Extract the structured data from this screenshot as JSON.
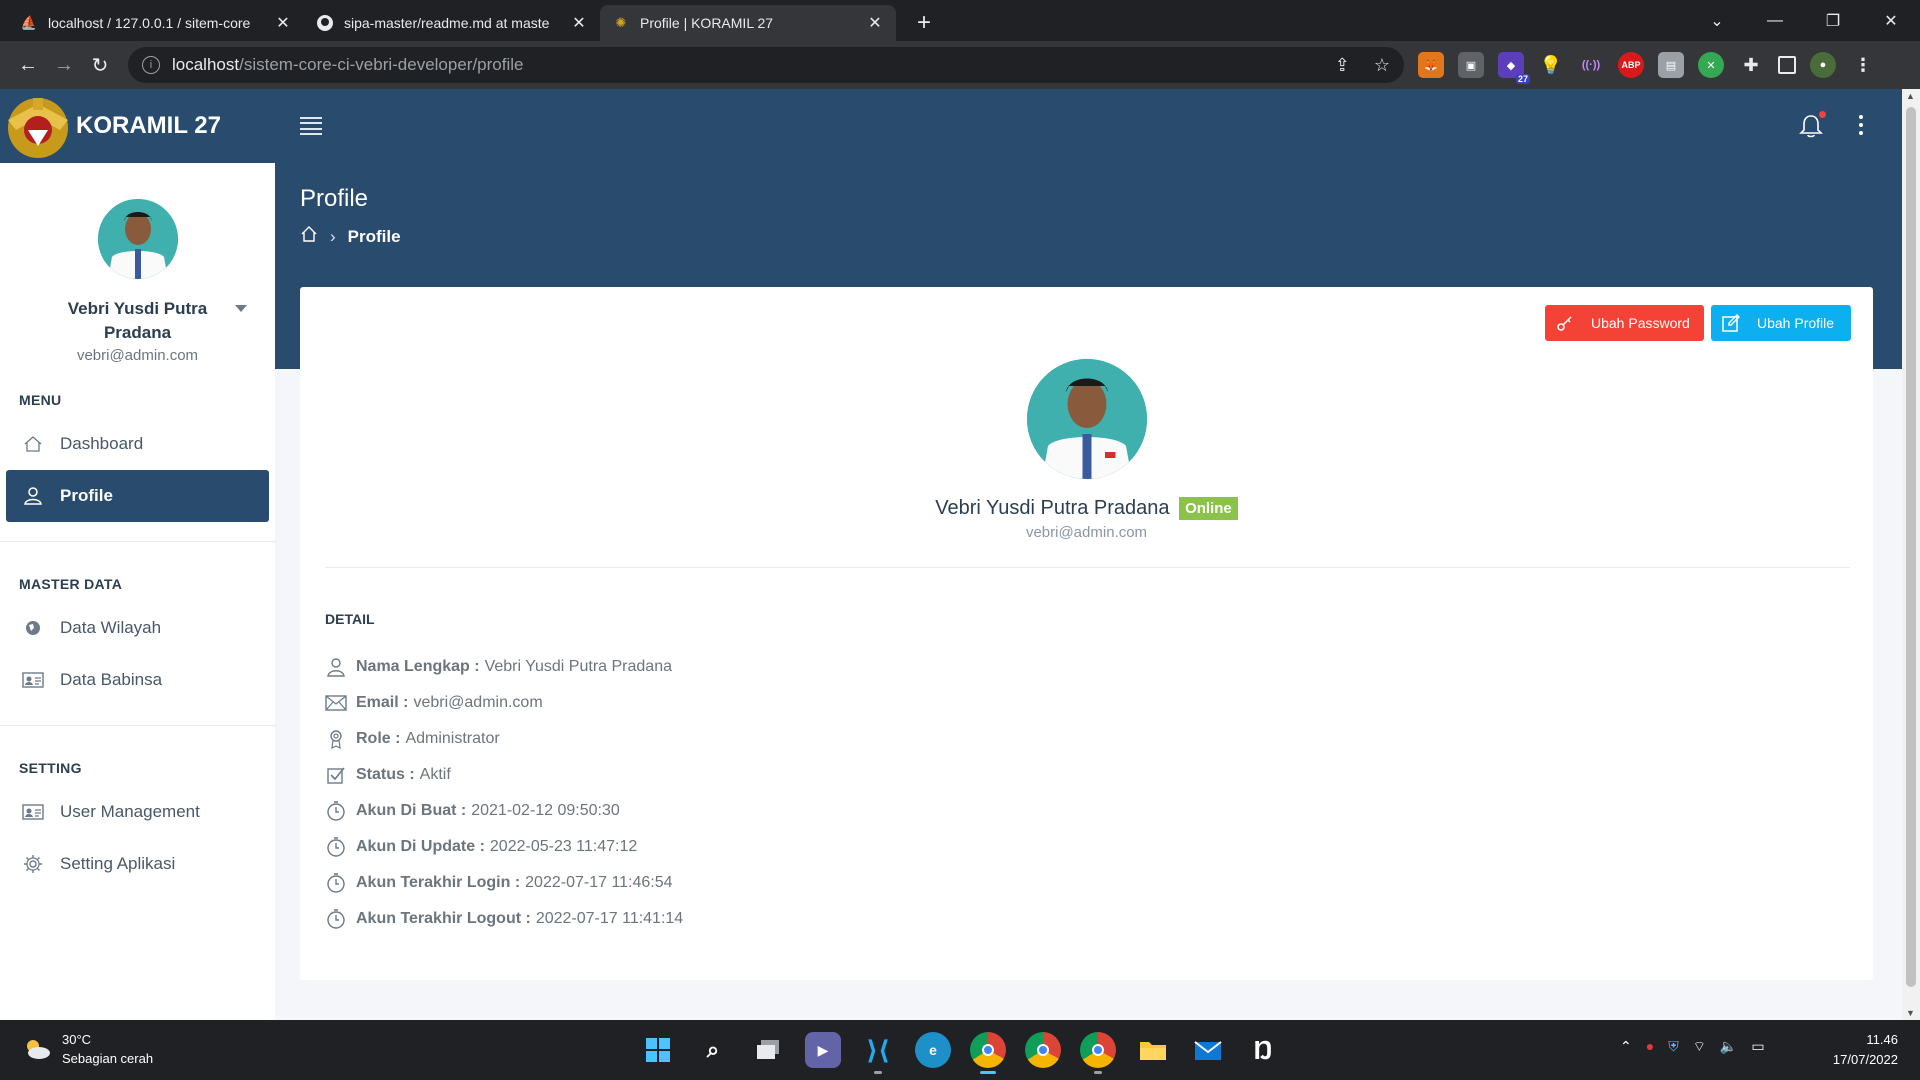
{
  "browser": {
    "tabs": [
      {
        "title": "localhost / 127.0.0.1 / sitem-core",
        "icon": "phpmyadmin-icon"
      },
      {
        "title": "sipa-master/readme.md at maste",
        "icon": "github-icon"
      },
      {
        "title": "Profile | KORAMIL 27",
        "icon": "koramil-logo-icon",
        "active": true
      }
    ],
    "address_host": "localhost",
    "address_path": "/sistem-core-ci-vebri-developer/profile",
    "extension_badge": "27",
    "abp_label": "ABP"
  },
  "app": {
    "brand_name": "KORAMIL 27",
    "page_title": "Profile",
    "breadcrumb_current": "Profile"
  },
  "sidebar": {
    "user_name": "Vebri Yusdi Putra Pradana",
    "user_email": "vebri@admin.com",
    "sections": [
      {
        "heading": "MENU",
        "items": [
          {
            "label": "Dashboard",
            "icon": "home-icon"
          },
          {
            "label": "Profile",
            "icon": "user-icon",
            "active": true
          }
        ]
      },
      {
        "heading": "MASTER DATA",
        "items": [
          {
            "label": "Data Wilayah",
            "icon": "globe-icon"
          },
          {
            "label": "Data Babinsa",
            "icon": "id-card-icon"
          }
        ]
      },
      {
        "heading": "SETTING",
        "items": [
          {
            "label": "User Management",
            "icon": "id-card-icon"
          },
          {
            "label": "Setting Aplikasi",
            "icon": "gear-icon"
          }
        ]
      }
    ]
  },
  "profile": {
    "btn_password": "Ubah Password",
    "btn_profile": "Ubah Profile",
    "name": "Vebri Yusdi Putra Pradana",
    "status_badge": "Online",
    "email": "vebri@admin.com",
    "detail_heading": "DETAIL",
    "details": [
      {
        "key": "Nama Lengkap :",
        "value": "Vebri Yusdi Putra Pradana",
        "icon": "user-icon"
      },
      {
        "key": "Email :",
        "value": "vebri@admin.com",
        "icon": "envelope-icon"
      },
      {
        "key": "Role :",
        "value": "Administrator",
        "icon": "award-icon"
      },
      {
        "key": "Status :",
        "value": "Aktif",
        "icon": "check-square-icon"
      },
      {
        "key": "Akun Di Buat :",
        "value": "2021-02-12 09:50:30",
        "icon": "timer-icon"
      },
      {
        "key": "Akun Di Update :",
        "value": "2022-05-23 11:47:12",
        "icon": "timer-icon"
      },
      {
        "key": "Akun Terakhir Login :",
        "value": "2022-07-17 11:46:54",
        "icon": "timer-icon"
      },
      {
        "key": "Akun Terakhir Logout :",
        "value": "2022-07-17 11:41:14",
        "icon": "timer-icon"
      }
    ]
  },
  "taskbar": {
    "temperature": "30°C",
    "weather": "Sebagian cerah",
    "time": "11.46",
    "date": "17/07/2022"
  },
  "colors": {
    "primary": "#284b6e",
    "danger": "#f44336",
    "info": "#0dafef",
    "success": "#8bc34a"
  }
}
